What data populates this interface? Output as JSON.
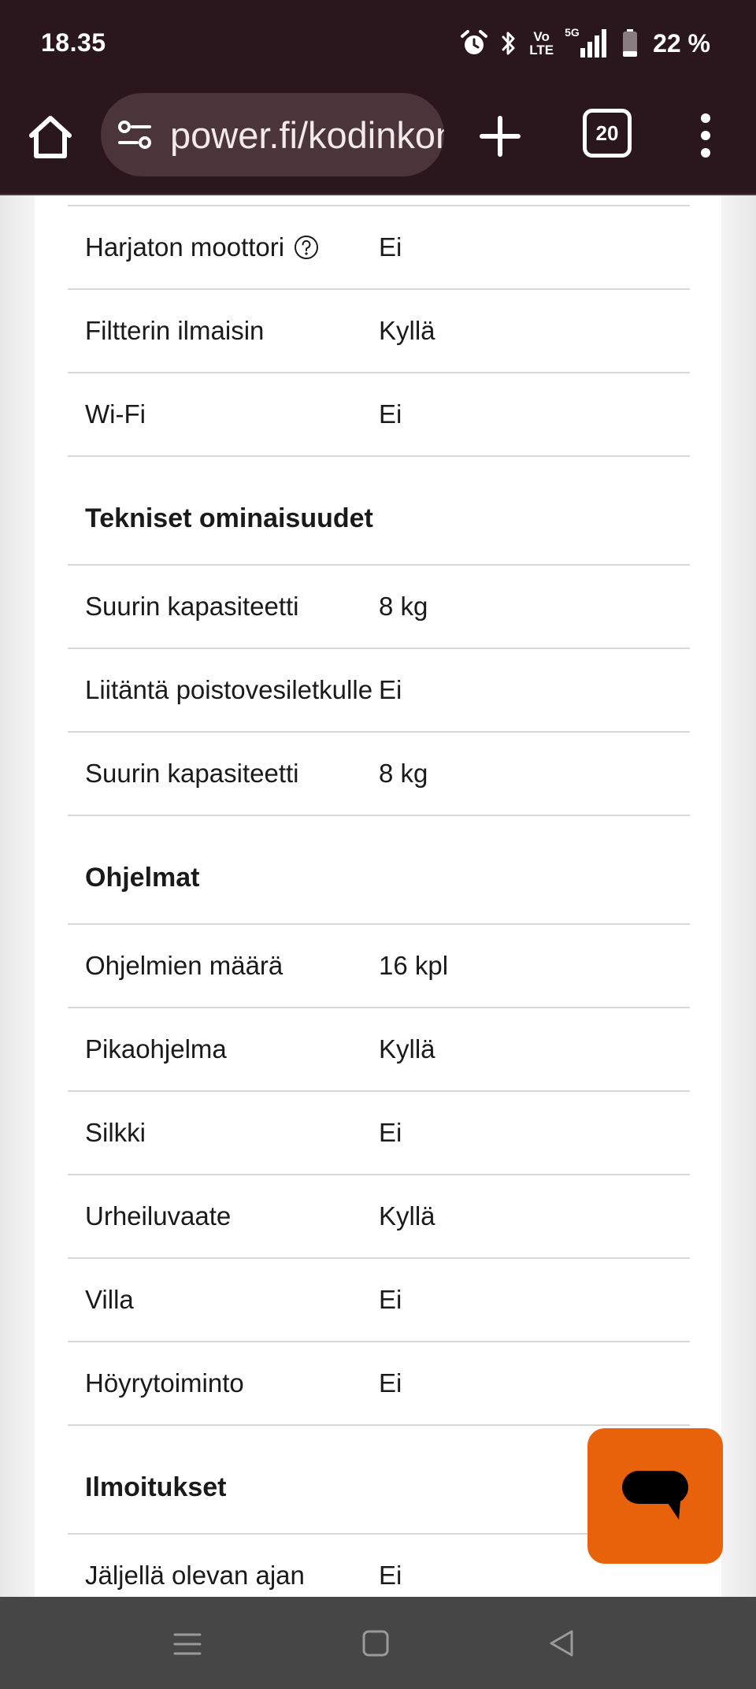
{
  "status_bar": {
    "time": "18.35",
    "volte_top": "Vo",
    "volte_bottom": "LTE",
    "network": "5G",
    "battery_text": "22 %",
    "battery_level": 0.22,
    "icons": [
      "alarm-icon",
      "bluetooth-icon",
      "signal-icon",
      "battery-icon"
    ]
  },
  "browser": {
    "url": "power.fi/kodinkoneet",
    "tab_count": "20",
    "icons": [
      "home-icon",
      "site-settings-icon",
      "plus-icon",
      "more-vert-icon"
    ]
  },
  "specs": {
    "top_rows": [
      {
        "label": "Harjaton moottori",
        "value": "Ei",
        "help": true
      },
      {
        "label": "Filtterin ilmaisin",
        "value": "Kyllä"
      },
      {
        "label": "Wi-Fi",
        "value": "Ei"
      }
    ],
    "sections": [
      {
        "heading": "Tekniset ominaisuudet",
        "rows": [
          {
            "label": "Suurin kapasiteetti",
            "value": "8 kg"
          },
          {
            "label": "Liitäntä poistovesiletkulle",
            "value": "Ei"
          },
          {
            "label": "Suurin kapasiteetti",
            "value": "8 kg"
          }
        ]
      },
      {
        "heading": "Ohjelmat",
        "rows": [
          {
            "label": "Ohjelmien määrä",
            "value": "16 kpl"
          },
          {
            "label": "Pikaohjelma",
            "value": "Kyllä"
          },
          {
            "label": "Silkki",
            "value": "Ei"
          },
          {
            "label": "Urheiluvaate",
            "value": "Kyllä"
          },
          {
            "label": "Villa",
            "value": "Ei"
          },
          {
            "label": "Höyrytoiminto",
            "value": "Ei"
          }
        ]
      },
      {
        "heading": "Ilmoitukset",
        "rows": [
          {
            "label": "Jäljellä olevan ajan ilmaisin",
            "value": "Ei"
          }
        ]
      }
    ]
  },
  "chat": {
    "icon": "chat-bubble-icon",
    "color": "#e8620c"
  },
  "nav_bar": {
    "icons": [
      "recent-apps-icon",
      "home-square-icon",
      "back-icon"
    ]
  },
  "colors": {
    "browser_chrome": "#2a171e",
    "omnibox": "#4a353b",
    "nav_bar": "#464646",
    "accent": "#e8620c"
  }
}
